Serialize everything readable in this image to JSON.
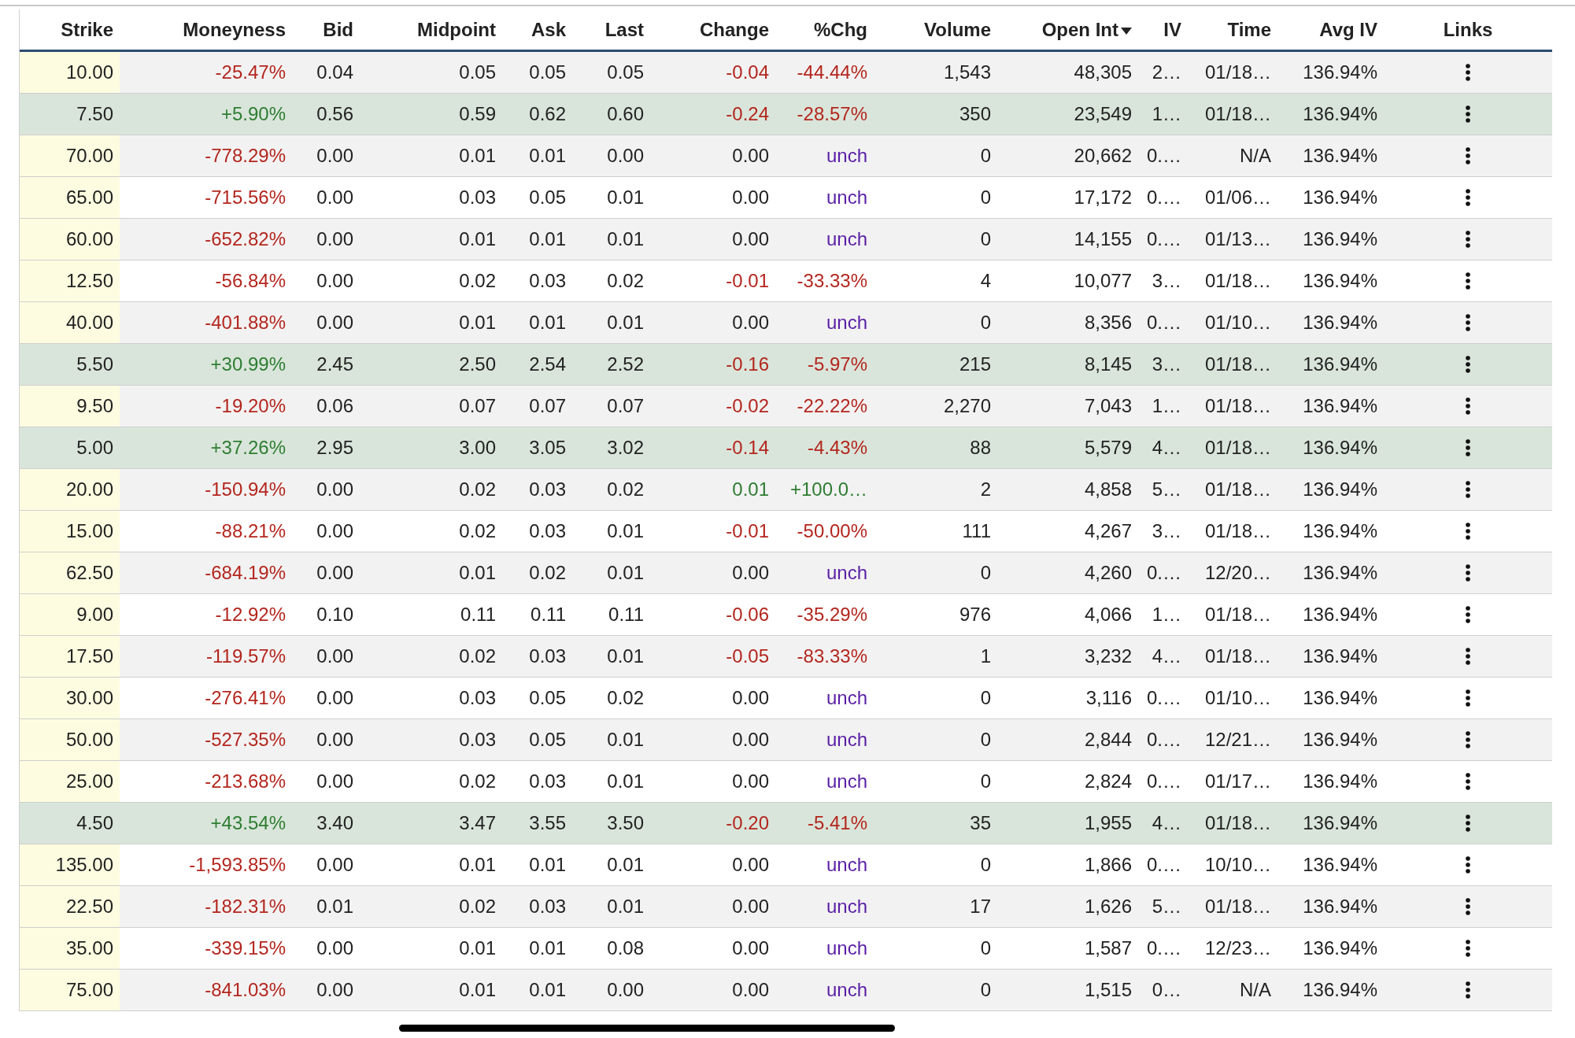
{
  "table": {
    "columns": [
      {
        "label": "Strike",
        "sorted": false
      },
      {
        "label": "Moneyness",
        "sorted": false
      },
      {
        "label": "Bid",
        "sorted": false
      },
      {
        "label": "Midpoint",
        "sorted": false
      },
      {
        "label": "Ask",
        "sorted": false
      },
      {
        "label": "Last",
        "sorted": false
      },
      {
        "label": "Change",
        "sorted": false
      },
      {
        "label": "%Chg",
        "sorted": false
      },
      {
        "label": "Volume",
        "sorted": false
      },
      {
        "label": "Open Int",
        "sorted": true
      },
      {
        "label": "IV",
        "sorted": false
      },
      {
        "label": "Time",
        "sorted": false
      },
      {
        "label": "Avg IV",
        "sorted": false
      },
      {
        "label": "Links",
        "sorted": false
      }
    ],
    "rows": [
      {
        "cells": [
          "10.00",
          "-25.47%",
          "0.04",
          "0.05",
          "0.05",
          "0.05",
          "-0.04",
          "-44.44%",
          "1,543",
          "48,305",
          "2…",
          "01/18…",
          "136.94%"
        ],
        "in_the_money": false,
        "rising": false,
        "falling": true
      },
      {
        "cells": [
          "7.50",
          "+5.90%",
          "0.56",
          "0.59",
          "0.62",
          "0.60",
          "-0.24",
          "-28.57%",
          "350",
          "23,549",
          "1…",
          "01/18…",
          "136.94%"
        ],
        "in_the_money": true,
        "rising": false,
        "falling": true
      },
      {
        "cells": [
          "70.00",
          "-778.29%",
          "0.00",
          "0.01",
          "0.01",
          "0.00",
          "0.00",
          "unch",
          "0",
          "20,662",
          "0.…",
          "N/A",
          "136.94%"
        ],
        "in_the_money": false,
        "rising": false,
        "falling": false
      },
      {
        "cells": [
          "65.00",
          "-715.56%",
          "0.00",
          "0.03",
          "0.05",
          "0.01",
          "0.00",
          "unch",
          "0",
          "17,172",
          "0.…",
          "01/06…",
          "136.94%"
        ],
        "in_the_money": false,
        "rising": false,
        "falling": false
      },
      {
        "cells": [
          "60.00",
          "-652.82%",
          "0.00",
          "0.01",
          "0.01",
          "0.01",
          "0.00",
          "unch",
          "0",
          "14,155",
          "0.…",
          "01/13…",
          "136.94%"
        ],
        "in_the_money": false,
        "rising": false,
        "falling": false
      },
      {
        "cells": [
          "12.50",
          "-56.84%",
          "0.00",
          "0.02",
          "0.03",
          "0.02",
          "-0.01",
          "-33.33%",
          "4",
          "10,077",
          "3…",
          "01/18…",
          "136.94%"
        ],
        "in_the_money": false,
        "rising": false,
        "falling": true
      },
      {
        "cells": [
          "40.00",
          "-401.88%",
          "0.00",
          "0.01",
          "0.01",
          "0.01",
          "0.00",
          "unch",
          "0",
          "8,356",
          "0.…",
          "01/10…",
          "136.94%"
        ],
        "in_the_money": false,
        "rising": false,
        "falling": false
      },
      {
        "cells": [
          "5.50",
          "+30.99%",
          "2.45",
          "2.50",
          "2.54",
          "2.52",
          "-0.16",
          "-5.97%",
          "215",
          "8,145",
          "3…",
          "01/18…",
          "136.94%"
        ],
        "in_the_money": true,
        "rising": false,
        "falling": true
      },
      {
        "cells": [
          "9.50",
          "-19.20%",
          "0.06",
          "0.07",
          "0.07",
          "0.07",
          "-0.02",
          "-22.22%",
          "2,270",
          "7,043",
          "1…",
          "01/18…",
          "136.94%"
        ],
        "in_the_money": false,
        "rising": false,
        "falling": true
      },
      {
        "cells": [
          "5.00",
          "+37.26%",
          "2.95",
          "3.00",
          "3.05",
          "3.02",
          "-0.14",
          "-4.43%",
          "88",
          "5,579",
          "4…",
          "01/18…",
          "136.94%"
        ],
        "in_the_money": true,
        "rising": false,
        "falling": true
      },
      {
        "cells": [
          "20.00",
          "-150.94%",
          "0.00",
          "0.02",
          "0.03",
          "0.02",
          "0.01",
          "+100.0…",
          "2",
          "4,858",
          "5…",
          "01/18…",
          "136.94%"
        ],
        "in_the_money": false,
        "rising": true,
        "falling": false
      },
      {
        "cells": [
          "15.00",
          "-88.21%",
          "0.00",
          "0.02",
          "0.03",
          "0.01",
          "-0.01",
          "-50.00%",
          "111",
          "4,267",
          "3…",
          "01/18…",
          "136.94%"
        ],
        "in_the_money": false,
        "rising": false,
        "falling": true
      },
      {
        "cells": [
          "62.50",
          "-684.19%",
          "0.00",
          "0.01",
          "0.02",
          "0.01",
          "0.00",
          "unch",
          "0",
          "4,260",
          "0.…",
          "12/20…",
          "136.94%"
        ],
        "in_the_money": false,
        "rising": false,
        "falling": false
      },
      {
        "cells": [
          "9.00",
          "-12.92%",
          "0.10",
          "0.11",
          "0.11",
          "0.11",
          "-0.06",
          "-35.29%",
          "976",
          "4,066",
          "1…",
          "01/18…",
          "136.94%"
        ],
        "in_the_money": false,
        "rising": false,
        "falling": true
      },
      {
        "cells": [
          "17.50",
          "-119.57%",
          "0.00",
          "0.02",
          "0.03",
          "0.01",
          "-0.05",
          "-83.33%",
          "1",
          "3,232",
          "4…",
          "01/18…",
          "136.94%"
        ],
        "in_the_money": false,
        "rising": false,
        "falling": true
      },
      {
        "cells": [
          "30.00",
          "-276.41%",
          "0.00",
          "0.03",
          "0.05",
          "0.02",
          "0.00",
          "unch",
          "0",
          "3,116",
          "0.…",
          "01/10…",
          "136.94%"
        ],
        "in_the_money": false,
        "rising": false,
        "falling": false
      },
      {
        "cells": [
          "50.00",
          "-527.35%",
          "0.00",
          "0.03",
          "0.05",
          "0.01",
          "0.00",
          "unch",
          "0",
          "2,844",
          "0.…",
          "12/21…",
          "136.94%"
        ],
        "in_the_money": false,
        "rising": false,
        "falling": false
      },
      {
        "cells": [
          "25.00",
          "-213.68%",
          "0.00",
          "0.02",
          "0.03",
          "0.01",
          "0.00",
          "unch",
          "0",
          "2,824",
          "0.…",
          "01/17…",
          "136.94%"
        ],
        "in_the_money": false,
        "rising": false,
        "falling": false
      },
      {
        "cells": [
          "4.50",
          "+43.54%",
          "3.40",
          "3.47",
          "3.55",
          "3.50",
          "-0.20",
          "-5.41%",
          "35",
          "1,955",
          "4…",
          "01/18…",
          "136.94%"
        ],
        "in_the_money": true,
        "rising": false,
        "falling": true
      },
      {
        "cells": [
          "135.00",
          "-1,593.85%",
          "0.00",
          "0.01",
          "0.01",
          "0.01",
          "0.00",
          "unch",
          "0",
          "1,866",
          "0.…",
          "10/10…",
          "136.94%"
        ],
        "in_the_money": false,
        "rising": false,
        "falling": false
      },
      {
        "cells": [
          "22.50",
          "-182.31%",
          "0.01",
          "0.02",
          "0.03",
          "0.01",
          "0.00",
          "unch",
          "17",
          "1,626",
          "5…",
          "01/18…",
          "136.94%"
        ],
        "in_the_money": false,
        "rising": false,
        "falling": false
      },
      {
        "cells": [
          "35.00",
          "-339.15%",
          "0.00",
          "0.01",
          "0.01",
          "0.08",
          "0.00",
          "unch",
          "0",
          "1,587",
          "0.…",
          "12/23…",
          "136.94%"
        ],
        "in_the_money": false,
        "rising": false,
        "falling": false
      },
      {
        "cells": [
          "75.00",
          "-841.03%",
          "0.00",
          "0.01",
          "0.01",
          "0.00",
          "0.00",
          "unch",
          "0",
          "1,515",
          "0…",
          "N/A",
          "136.94%"
        ],
        "in_the_money": false,
        "rising": false,
        "falling": false
      }
    ]
  }
}
